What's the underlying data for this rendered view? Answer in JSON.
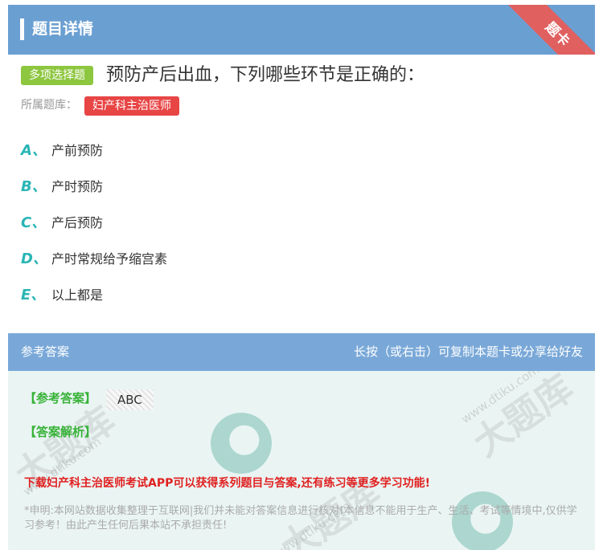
{
  "header": {
    "title": "题目详情",
    "ribbon": "题卡"
  },
  "question": {
    "type_tag": "多项选择题",
    "text": "预防产后出血，下列哪些环节是正确的：",
    "bank_label": "所属题库：",
    "bank_name": "妇产科主治医师"
  },
  "options": [
    {
      "letter": "A、",
      "text": "产前预防"
    },
    {
      "letter": "B、",
      "text": "产时预防"
    },
    {
      "letter": "C、",
      "text": "产后预防"
    },
    {
      "letter": "D、",
      "text": "产时常规给予缩宫素"
    },
    {
      "letter": "E、",
      "text": "以上都是"
    }
  ],
  "answer": {
    "section_label": "参考答案",
    "hint": "长按（或右击）可复制本题卡或分享给好友",
    "answer_label": "【参考答案】",
    "answer_value": "ABC",
    "analysis_label": "【答案解析】",
    "promo": "下载妇产科主治医师考试APP可以获得系列题目与答案,还有练习等更多学习功能!",
    "disclaimer": "*申明:本网站数据收集整理于互联网|我们并未能对答案信息进行核对!本信息不能用于生产、生活、考试等情境中,仅供学习参考！由此产生任何后果本站不承担责任!",
    "watermark_text": "大题库",
    "watermark_url": "www.dtiku.com"
  },
  "colors": {
    "header_bg": "#6a9fd2",
    "type_tag": "#8dc63f",
    "bank_tag": "#e84545",
    "option_letter": "#2bb5b5",
    "answer_green": "#38b238",
    "promo_red": "#e02020"
  }
}
